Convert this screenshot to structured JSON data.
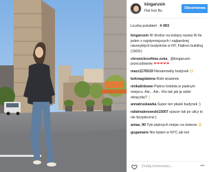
{
  "post": {
    "photo_alt": "Flatiron building street scene",
    "header": {
      "username": "kingarusin",
      "location": "Flat Iron Bu",
      "follow_label": "Obserwowa"
    },
    "likes_label": "Liczba polubień",
    "likes_count": "4 493",
    "time_ago": "",
    "comments": [
      {
        "user": "kingarusin",
        "text": " W drodze na kolejny wywia W tle jeden z najsłynniejszych i najbardziej niezwykłych budynków w NY, Flatiron building (1902r)"
      },
      {
        "user": "chroniclesoftmo.sska_",
        "text": " @kingarusin przecudownie ",
        "hearts": "❤❤❤❤❤"
      },
      {
        "user": "mazz1176519",
        "text": " Niesamowity budynek ",
        "emoji": "😍"
      },
      {
        "user": "bekmagdalena",
        "text": " Robi wrażenie"
      },
      {
        "user": "ninkalinkowe",
        "text": " Piękno kobieta w pięknym miejscu. Ale... Ale.. Kto tak jak ja widzi obrączkę?",
        "emoji": ";)"
      },
      {
        "user": "annatruskawka",
        "text": " Super ten płaski budynek :)"
      },
      {
        "user": "rafalmalenowski15007",
        "text": " spacer tak po ulicy to nie bezpieczne:)"
      },
      {
        "user": "aniaa_90",
        "text": " Tyle pięknych miejsc na świecie ",
        "emoji": "😍"
      },
      {
        "user": "gugamarie",
        "text": " Nie byłam w NYC ale ten"
      }
    ],
    "add_comment_placeholder": "Dodaj komentarz..."
  },
  "icons": {
    "like": "heart-outline-icon",
    "more": "more-options-icon"
  },
  "colors": {
    "follow_button": "#3897f0",
    "heart": "#ed4956"
  }
}
